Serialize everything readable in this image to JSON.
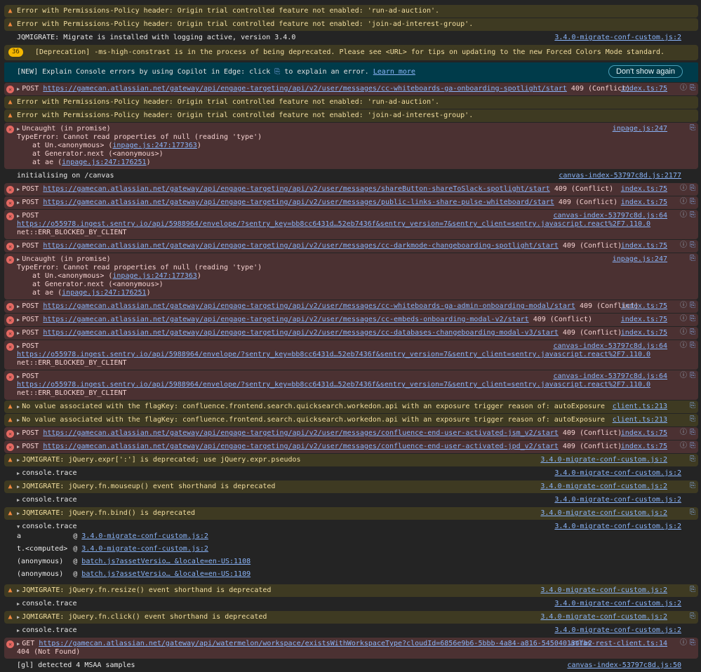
{
  "banner": {
    "text_before": "[NEW] Explain Console errors by using Copilot in Edge: click",
    "text_after": "to explain an error.",
    "learn_more": "Learn more",
    "dont_show": "Don't show again"
  },
  "colors": {
    "warn_bg": "#3e3a22",
    "error_bg": "#4b3132",
    "banner_bg": "#003b4a",
    "link": "#8ab4f8"
  },
  "rows": [
    {
      "type": "warn",
      "lines": [
        [
          {
            "t": "Error with Permissions-Policy header: Origin trial controlled feature not enabled: 'run-ad-auction'."
          }
        ]
      ]
    },
    {
      "type": "warn",
      "lines": [
        [
          {
            "t": "Error with Permissions-Policy header: Origin trial controlled feature not enabled: 'join-ad-interest-group'."
          }
        ]
      ]
    },
    {
      "type": "info",
      "lines": [
        [
          {
            "t": "JQMIGRATE: Migrate is installed with logging active, version 3.4.0"
          }
        ]
      ],
      "source": "3.4.0-migrate-conf-custom.js:2"
    },
    {
      "type": "dep",
      "badge": "36",
      "lines": [
        [
          {
            "t": "[Deprecation] -ms-high-constrast is in the process of being deprecated. Please see <URL> for tips on updating to the new Forced Colors Mode standard."
          }
        ]
      ]
    },
    {
      "type": "banner"
    },
    {
      "type": "error",
      "tri": "r",
      "lines": [
        [
          {
            "t": "POST "
          },
          {
            "l": "https://gamecan.atlassian.net/gateway/api/engage-targeting/api/v2/user/messages/cc-whiteboards-ga-onboarding-spotlight/start"
          },
          {
            "t": " 409 (Conflict)"
          }
        ]
      ],
      "source": "index.ts:75",
      "icons": true
    },
    {
      "type": "warn",
      "lines": [
        [
          {
            "t": "Error with Permissions-Policy header: Origin trial controlled feature not enabled: 'run-ad-auction'."
          }
        ]
      ]
    },
    {
      "type": "warn",
      "lines": [
        [
          {
            "t": "Error with Permissions-Policy header: Origin trial controlled feature not enabled: 'join-ad-interest-group'."
          }
        ]
      ]
    },
    {
      "type": "error",
      "tri": "r",
      "lines": [
        [
          {
            "t": "Uncaught (in promise)"
          }
        ],
        [
          {
            "t": "TypeError: Cannot read properties of null (reading 'type')"
          }
        ],
        [
          {
            "i": 1,
            "t": "at Un.<anonymous> ("
          },
          {
            "l": "inpage.js:247:177363"
          },
          {
            "t": ")"
          }
        ],
        [
          {
            "i": 1,
            "t": "at Generator.next (<anonymous>)"
          }
        ],
        [
          {
            "i": 1,
            "t": "at ae ("
          },
          {
            "l": "inpage.js:247:176251"
          },
          {
            "t": ")"
          }
        ]
      ],
      "source": "inpage.js:247",
      "icons": "copilot"
    },
    {
      "type": "info",
      "lines": [
        [
          {
            "t": "initialising on /canvas"
          }
        ]
      ],
      "source": "canvas-index-53797c8d.js:2177"
    },
    {
      "type": "error",
      "tri": "r",
      "lines": [
        [
          {
            "t": "POST "
          },
          {
            "l": "https://gamecan.atlassian.net/gateway/api/engage-targeting/api/v2/user/messages/shareButton-shareToSlack-spotlight/start"
          },
          {
            "t": " 409 (Conflict)"
          }
        ]
      ],
      "source": "index.ts:75",
      "icons": true
    },
    {
      "type": "error",
      "tri": "r",
      "lines": [
        [
          {
            "t": "POST "
          },
          {
            "l": "https://gamecan.atlassian.net/gateway/api/engage-targeting/api/v2/user/messages/public-links-share-pulse-whiteboard/start"
          },
          {
            "t": " 409 (Conflict)"
          }
        ]
      ],
      "source": "index.ts:75",
      "icons": true
    },
    {
      "type": "error",
      "tri": "r",
      "lines": [
        [
          {
            "t": "POST"
          }
        ],
        [
          {
            "l": "https://o55978.ingest.sentry.io/api/5988964/envelope/?sentry_key=bb8cc6431d…52eb7436f&sentry_version=7&sentry_client=sentry.javascript.react%2F7.110.0"
          }
        ],
        [
          {
            "t": "net::ERR_BLOCKED_BY_CLIENT"
          }
        ]
      ],
      "source": "canvas-index-53797c8d.js:64",
      "icons": true
    },
    {
      "type": "error",
      "tri": "r",
      "lines": [
        [
          {
            "t": "POST "
          },
          {
            "l": "https://gamecan.atlassian.net/gateway/api/engage-targeting/api/v2/user/messages/cc-darkmode-changeboarding-spotlight/start"
          },
          {
            "t": " 409 (Conflict)"
          }
        ]
      ],
      "source": "index.ts:75",
      "icons": true
    },
    {
      "type": "error",
      "tri": "r",
      "lines": [
        [
          {
            "t": "Uncaught (in promise)"
          }
        ],
        [
          {
            "t": "TypeError: Cannot read properties of null (reading 'type')"
          }
        ],
        [
          {
            "i": 1,
            "t": "at Un.<anonymous> ("
          },
          {
            "l": "inpage.js:247:177363"
          },
          {
            "t": ")"
          }
        ],
        [
          {
            "i": 1,
            "t": "at Generator.next (<anonymous>)"
          }
        ],
        [
          {
            "i": 1,
            "t": "at ae ("
          },
          {
            "l": "inpage.js:247:176251"
          },
          {
            "t": ")"
          }
        ]
      ],
      "source": "inpage.js:247",
      "icons": "copilot"
    },
    {
      "type": "error",
      "tri": "r",
      "lines": [
        [
          {
            "t": "POST "
          },
          {
            "l": "https://gamecan.atlassian.net/gateway/api/engage-targeting/api/v2/user/messages/cc-whiteboards-ga-admin-onboarding-modal/start"
          },
          {
            "t": " 409 (Conflict)"
          }
        ]
      ],
      "source": "index.ts:75",
      "icons": true
    },
    {
      "type": "error",
      "tri": "r",
      "lines": [
        [
          {
            "t": "POST "
          },
          {
            "l": "https://gamecan.atlassian.net/gateway/api/engage-targeting/api/v2/user/messages/cc-embeds-onboarding-modal-v2/start"
          },
          {
            "t": " 409 (Conflict)"
          }
        ]
      ],
      "source": "index.ts:75",
      "icons": true
    },
    {
      "type": "error",
      "tri": "r",
      "lines": [
        [
          {
            "t": "POST "
          },
          {
            "l": "https://gamecan.atlassian.net/gateway/api/engage-targeting/api/v2/user/messages/cc-databases-changeboarding-modal-v3/start"
          },
          {
            "t": " 409 (Conflict)"
          }
        ]
      ],
      "source": "index.ts:75",
      "icons": true
    },
    {
      "type": "error",
      "tri": "r",
      "lines": [
        [
          {
            "t": "POST"
          }
        ],
        [
          {
            "l": "https://o55978.ingest.sentry.io/api/5988964/envelope/?sentry_key=bb8cc6431d…52eb7436f&sentry_version=7&sentry_client=sentry.javascript.react%2F7.110.0"
          }
        ],
        [
          {
            "t": "net::ERR_BLOCKED_BY_CLIENT"
          }
        ]
      ],
      "source": "canvas-index-53797c8d.js:64",
      "icons": true
    },
    {
      "type": "error",
      "tri": "r",
      "lines": [
        [
          {
            "t": "POST"
          }
        ],
        [
          {
            "l": "https://o55978.ingest.sentry.io/api/5988964/envelope/?sentry_key=bb8cc6431d…52eb7436f&sentry_version=7&sentry_client=sentry.javascript.react%2F7.110.0"
          }
        ],
        [
          {
            "t": "net::ERR_BLOCKED_BY_CLIENT"
          }
        ]
      ],
      "source": "canvas-index-53797c8d.js:64",
      "icons": true
    },
    {
      "type": "warn",
      "tri": "r",
      "lines": [
        [
          {
            "t": "No value associated with the flagKey: confluence.frontend.search.quicksearch.workedon.api with an exposure trigger reason of: autoExposure"
          }
        ]
      ],
      "source": "client.ts:213",
      "icons": "copilot"
    },
    {
      "type": "warn",
      "tri": "r",
      "lines": [
        [
          {
            "t": "No value associated with the flagKey: confluence.frontend.search.quicksearch.workedon.api with an exposure trigger reason of: autoExposure"
          }
        ]
      ],
      "source": "client.ts:213",
      "icons": "copilot"
    },
    {
      "type": "error",
      "tri": "r",
      "lines": [
        [
          {
            "t": "POST "
          },
          {
            "l": "https://gamecan.atlassian.net/gateway/api/engage-targeting/api/v2/user/messages/confluence-end-user-activated-jsm_v2/start"
          },
          {
            "t": " 409 (Conflict)"
          }
        ]
      ],
      "source": "index.ts:75",
      "icons": true
    },
    {
      "type": "error",
      "tri": "r",
      "lines": [
        [
          {
            "t": "POST "
          },
          {
            "l": "https://gamecan.atlassian.net/gateway/api/engage-targeting/api/v2/user/messages/confluence-end-user-activated-jpd_v2/start"
          },
          {
            "t": " 409 (Conflict)"
          }
        ]
      ],
      "source": "index.ts:75",
      "icons": true
    },
    {
      "type": "warn",
      "tri": "r",
      "lines": [
        [
          {
            "t": "JQMIGRATE: jQuery.expr[':'] is deprecated; use jQuery.expr.pseudos"
          }
        ]
      ],
      "source": "3.4.0-migrate-conf-custom.js:2",
      "icons": "copilot"
    },
    {
      "type": "info",
      "tri": "r",
      "lines": [
        [
          {
            "t": "console.trace"
          }
        ]
      ],
      "source": "3.4.0-migrate-conf-custom.js:2"
    },
    {
      "type": "warn",
      "tri": "r",
      "lines": [
        [
          {
            "t": "JQMIGRATE: jQuery.fn.mouseup() event shorthand is deprecated"
          }
        ]
      ],
      "source": "3.4.0-migrate-conf-custom.js:2",
      "icons": "copilot"
    },
    {
      "type": "info",
      "tri": "r",
      "lines": [
        [
          {
            "t": "console.trace"
          }
        ]
      ],
      "source": "3.4.0-migrate-conf-custom.js:2"
    },
    {
      "type": "warn",
      "tri": "r",
      "lines": [
        [
          {
            "t": "JQMIGRATE: jQuery.fn.bind() is deprecated"
          }
        ]
      ],
      "source": "3.4.0-migrate-conf-custom.js:2",
      "icons": "copilot"
    },
    {
      "type": "info",
      "tri": "d",
      "lines": [
        [
          {
            "t": "console.trace"
          }
        ]
      ],
      "source": "3.4.0-migrate-conf-custom.js:2",
      "trace": [
        {
          "fn": "a",
          "src": "3.4.0-migrate-conf-custom.js:2"
        },
        {
          "fn": "t.<computed>",
          "src": "3.4.0-migrate-conf-custom.js:2"
        },
        {
          "fn": "(anonymous)",
          "src": "batch.js?assetVersio… &locale=en-US:1108"
        },
        {
          "fn": "(anonymous)",
          "src": "batch.js?assetVersio… &locale=en-US:1109"
        }
      ]
    },
    {
      "type": "warn",
      "tri": "r",
      "lines": [
        [
          {
            "t": "JQMIGRATE: jQuery.fn.resize() event shorthand is deprecated"
          }
        ]
      ],
      "source": "3.4.0-migrate-conf-custom.js:2",
      "icons": "copilot"
    },
    {
      "type": "info",
      "tri": "r",
      "lines": [
        [
          {
            "t": "console.trace"
          }
        ]
      ],
      "source": "3.4.0-migrate-conf-custom.js:2"
    },
    {
      "type": "warn",
      "tri": "r",
      "lines": [
        [
          {
            "t": "JQMIGRATE: jQuery.fn.click() event shorthand is deprecated"
          }
        ]
      ],
      "source": "3.4.0-migrate-conf-custom.js:2",
      "icons": "copilot"
    },
    {
      "type": "info",
      "tri": "r",
      "lines": [
        [
          {
            "t": "console.trace"
          }
        ]
      ],
      "source": "3.4.0-migrate-conf-custom.js:2"
    },
    {
      "type": "error",
      "tri": "r",
      "lines": [
        [
          {
            "t": "GET "
          },
          {
            "l": "https://gamecan.atlassian.net/gateway/api/watermelon/workspace/existsWithWorkspaceType?cloudId=6856e9b6-5bbb-4a84-a816-545040134fb2"
          }
        ],
        [
          {
            "t": "404 (Not Found)"
          }
        ]
      ],
      "source": "atlas-rest-client.ts:14",
      "icons": true
    },
    {
      "type": "info",
      "lines": [
        [
          {
            "t": "[gl] detected 4 MSAA samples"
          }
        ]
      ],
      "source": "canvas-index-53797c8d.js:50"
    }
  ]
}
